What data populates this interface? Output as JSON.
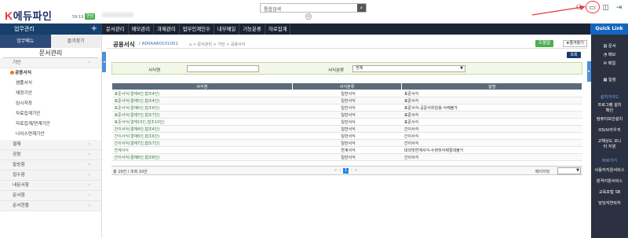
{
  "header": {
    "logo_k": "K",
    "logo_text": "에듀파인",
    "timer": "59:19",
    "extend_button": "연장",
    "search_placeholder": "통합검색",
    "plus": "+"
  },
  "nav": {
    "sys_label": "업무관리",
    "sys_plus": "+",
    "items": [
      "문서관리",
      "메모관리",
      "과제관리",
      "업무인계인수",
      "내부메일",
      "기능분류",
      "자료집계"
    ],
    "quick_link": "Quick Link"
  },
  "left": {
    "tabs": [
      "업무메뉴",
      "즐겨찾기"
    ],
    "title": "문서관리",
    "items": [
      {
        "label": "기안",
        "type": "cat"
      },
      {
        "label": "공용서식",
        "type": "open"
      },
      {
        "label": "샘플서식",
        "type": "sub"
      },
      {
        "label": "재정기안",
        "type": "sub"
      },
      {
        "label": "임시저장",
        "type": "sub"
      },
      {
        "label": "자료집계기안",
        "type": "sub"
      },
      {
        "label": "자료집계/연계기안",
        "type": "sub"
      },
      {
        "label": "나이스연계기안",
        "type": "sub"
      },
      {
        "label": "결재",
        "type": "cat"
      },
      {
        "label": "공람",
        "type": "cat"
      },
      {
        "label": "발송함",
        "type": "cat"
      },
      {
        "label": "접수함",
        "type": "cat"
      },
      {
        "label": "내문서함",
        "type": "cat"
      },
      {
        "label": "문서함",
        "type": "cat"
      },
      {
        "label": "문서현황",
        "type": "cat"
      }
    ]
  },
  "page": {
    "title": "공용서식",
    "code": "A00AA80101001",
    "breadcrumb": "문서관리 > 기안 > 공용서식",
    "btn_green": "도움말",
    "btn_fav": "즐겨찾기",
    "search_btn": "조회",
    "filter_label1": "서식명",
    "filter_label2": "서식분류",
    "filter_select2": "전체",
    "columns": [
      "서식명",
      "서식분류",
      "설명"
    ],
    "rows": [
      [
        "표준서식(결재4인,협조4인)",
        "일반서식",
        "표준서식"
      ],
      [
        "표준서식(결재5인,협조4인)",
        "일반서식",
        "표준서식"
      ],
      [
        "표준서식(결재6인,협조6인)",
        "일반서식",
        "표준서식-공문서위원용-삭제불가"
      ],
      [
        "표준서식(결재7인,협조7인)",
        "일반서식",
        "표준서식"
      ],
      [
        "표준서식(결재10인,협조10인)",
        "일반서식",
        "표준서식"
      ],
      [
        "간이서식(결재4인,협조4인)",
        "일반서식",
        "간이서식"
      ],
      [
        "간이서식(결재6인,협조6인)",
        "일반서식",
        "간이서식"
      ],
      [
        "간이서식(결재7인,협조7인)",
        "일반서식",
        "간이서식"
      ],
      [
        "연계서식",
        "연계서식",
        "대외및연계서식-수정및삭제절대불가"
      ],
      [
        "간이서식(결재8인,협조8인)",
        "일반서식",
        "간이서식"
      ]
    ],
    "count_text": "총 10건 / 조회 10건",
    "page_current": "1",
    "per_page_label": "페이지당",
    "per_page_value": ""
  },
  "right": {
    "items_top": [
      "문서",
      "메모",
      "메일",
      "일정"
    ],
    "section1": "설치가이드",
    "items1": [
      "프로그램 설치확인",
      "컴퓨터보안설치",
      "OS/브라우저",
      "고해상도 모니터 지원"
    ],
    "section2": "바로가기",
    "items2": [
      "사용자지원서비스",
      "원격지원서비스",
      "교육포털 SB",
      "담당자연락처"
    ]
  }
}
